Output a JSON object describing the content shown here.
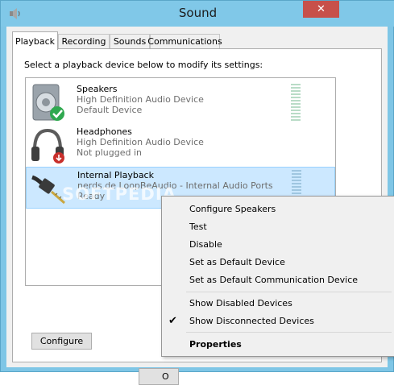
{
  "window": {
    "title": "Sound",
    "close_glyph": "✕"
  },
  "tabs": [
    {
      "label": "Playback",
      "active": true
    },
    {
      "label": "Recording",
      "active": false
    },
    {
      "label": "Sounds",
      "active": false
    },
    {
      "label": "Communications",
      "active": false
    }
  ],
  "playback": {
    "instruction": "Select a playback device below to modify its settings:",
    "devices": [
      {
        "name": "Speakers",
        "line1": "High Definition Audio Device",
        "line2": "Default Device",
        "icon": "speaker-icon",
        "status_icon": "green-check-icon",
        "selected": false
      },
      {
        "name": "Headphones",
        "line1": "High Definition Audio Device",
        "line2": "Not plugged in",
        "icon": "headphones-icon",
        "status_icon": "red-down-arrow-icon",
        "selected": false
      },
      {
        "name": "Internal Playback",
        "line1": "nerds.de LoopBeAudio - Internal Audio Ports",
        "line2": "Ready",
        "icon": "audio-jack-icon",
        "status_icon": "",
        "selected": true
      }
    ],
    "configure_label": "Configure",
    "ok_label": "O"
  },
  "context_menu": {
    "items": [
      {
        "label": "Configure Speakers",
        "checked": false,
        "bold": false
      },
      {
        "label": "Test",
        "checked": false,
        "bold": false
      },
      {
        "label": "Disable",
        "checked": false,
        "bold": false
      },
      {
        "label": "Set as Default Device",
        "checked": false,
        "bold": false
      },
      {
        "label": "Set as Default Communication Device",
        "checked": false,
        "bold": false
      },
      {
        "label": "Show Disabled Devices",
        "checked": false,
        "bold": false
      },
      {
        "label": "Show Disconnected Devices",
        "checked": true,
        "bold": false
      },
      {
        "label": "Properties",
        "checked": false,
        "bold": true
      }
    ],
    "check_glyph": "✔"
  },
  "watermark": "SOFTPEDIA",
  "colors": {
    "title_bar": "#80c8e8",
    "close_button": "#c7504a",
    "selection": "#cce8ff"
  }
}
